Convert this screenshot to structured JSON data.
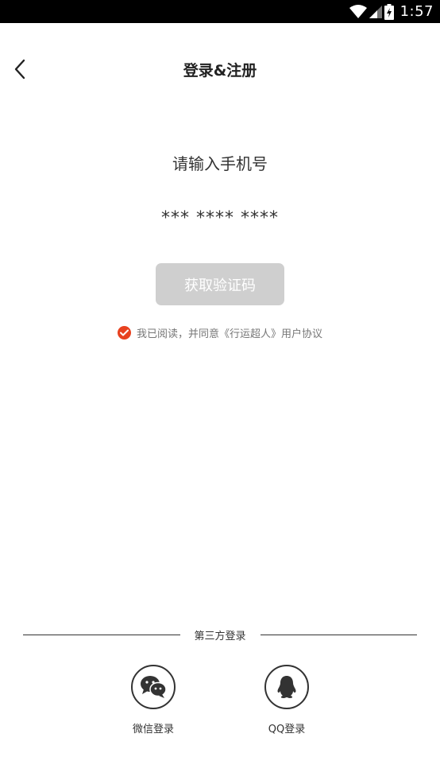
{
  "status_bar": {
    "time": "1:57",
    "icons": [
      "wifi-icon",
      "signal-icon",
      "battery-charging-icon"
    ]
  },
  "header": {
    "back_icon": "back-arrow-icon",
    "title": "登录&注册"
  },
  "form": {
    "prompt": "请输入手机号",
    "phone_placeholder": "*** **** ****",
    "phone_value": "",
    "get_code_label": "获取验证码"
  },
  "agreement": {
    "checked": true,
    "text": "我已阅读，并同意《行运超人》用户协议"
  },
  "third_party": {
    "label": "第三方登录",
    "options": [
      {
        "label": "微信登录",
        "icon": "wechat-icon"
      },
      {
        "label": "QQ登录",
        "icon": "qq-icon"
      }
    ]
  },
  "colors": {
    "accent": "#e8411f",
    "disabled_button": "#cfcfcf",
    "text_primary": "#222222",
    "text_secondary": "#777777"
  }
}
